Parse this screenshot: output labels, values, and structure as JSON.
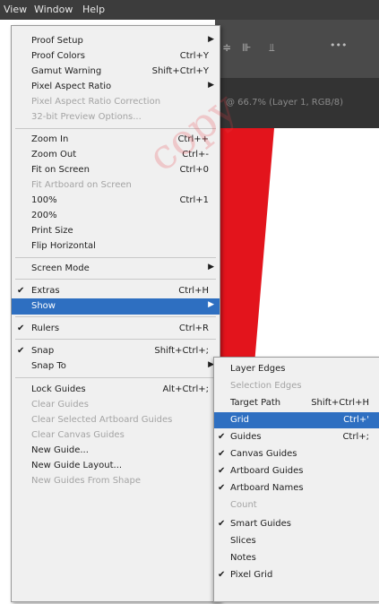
{
  "menubar": {
    "items": [
      "View",
      "Window",
      "Help"
    ]
  },
  "toolbar": {
    "icons": [
      {
        "name": "align-center-icon",
        "glyph": "≑"
      },
      {
        "name": "distribute-icon",
        "glyph": "⊪"
      },
      {
        "name": "align-bottom-icon",
        "glyph": "⫫"
      },
      {
        "name": "more-options-icon",
        "glyph": "•••"
      }
    ]
  },
  "tab": {
    "text": "@ 66.7% (Layer 1, RGB/8)"
  },
  "watermark": "copy",
  "colors": {
    "accent": "#2e6fc1",
    "artwork": "#e3141c",
    "menubar": "#3c3c3c"
  },
  "view_menu": {
    "items": [
      {
        "label": "Proof Setup",
        "submenu": true
      },
      {
        "label": "Proof Colors",
        "shortcut": "Ctrl+Y"
      },
      {
        "label": "Gamut Warning",
        "shortcut": "Shift+Ctrl+Y"
      },
      {
        "label": "Pixel Aspect Ratio",
        "submenu": true
      },
      {
        "label": "Pixel Aspect Ratio Correction",
        "disabled": true
      },
      {
        "label": "32-bit Preview Options...",
        "disabled": true
      },
      {
        "label": "Zoom In",
        "shortcut": "Ctrl++"
      },
      {
        "label": "Zoom Out",
        "shortcut": "Ctrl+-"
      },
      {
        "label": "Fit on Screen",
        "shortcut": "Ctrl+0"
      },
      {
        "label": "Fit Artboard on Screen",
        "disabled": true
      },
      {
        "label": "100%",
        "shortcut": "Ctrl+1"
      },
      {
        "label": "200%"
      },
      {
        "label": "Print Size"
      },
      {
        "label": "Flip Horizontal"
      },
      {
        "label": "Screen Mode",
        "submenu": true
      },
      {
        "label": "Extras",
        "shortcut": "Ctrl+H",
        "checked": true
      },
      {
        "label": "Show",
        "submenu": true,
        "highlighted": true
      },
      {
        "label": "Rulers",
        "shortcut": "Ctrl+R",
        "checked": true
      },
      {
        "label": "Snap",
        "shortcut": "Shift+Ctrl+;",
        "checked": true
      },
      {
        "label": "Snap To",
        "submenu": true
      },
      {
        "label": "Lock Guides",
        "shortcut": "Alt+Ctrl+;"
      },
      {
        "label": "Clear Guides",
        "disabled": true
      },
      {
        "label": "Clear Selected Artboard Guides",
        "disabled": true
      },
      {
        "label": "Clear Canvas Guides",
        "disabled": true
      },
      {
        "label": "New Guide..."
      },
      {
        "label": "New Guide Layout..."
      },
      {
        "label": "New Guides From Shape",
        "disabled": true
      }
    ]
  },
  "show_submenu": {
    "items": [
      {
        "label": "Layer Edges"
      },
      {
        "label": "Selection Edges",
        "disabled": true
      },
      {
        "label": "Target Path",
        "shortcut": "Shift+Ctrl+H"
      },
      {
        "label": "Grid",
        "shortcut": "Ctrl+'",
        "highlighted": true
      },
      {
        "label": "Guides",
        "shortcut": "Ctrl+;",
        "checked": true
      },
      {
        "label": "Canvas Guides",
        "checked": true
      },
      {
        "label": "Artboard Guides",
        "checked": true
      },
      {
        "label": "Artboard Names",
        "checked": true
      },
      {
        "label": "Count",
        "disabled": true
      },
      {
        "label": "Smart Guides",
        "checked": true
      },
      {
        "label": "Slices"
      },
      {
        "label": "Notes"
      },
      {
        "label": "Pixel Grid",
        "checked": true
      }
    ]
  }
}
